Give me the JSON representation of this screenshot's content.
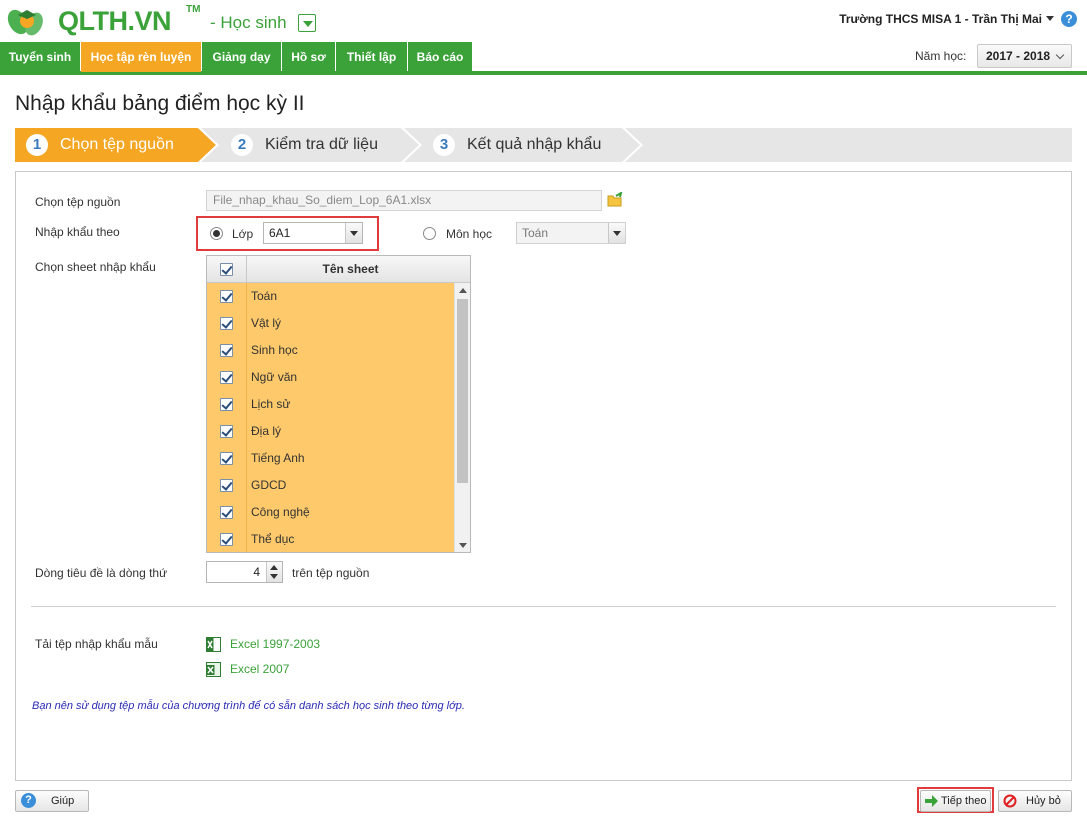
{
  "header": {
    "logo_text": "QLTH.VN",
    "logo_tm": "TM",
    "app_switch": "- Học sinh",
    "user_label": "Trường THCS MISA 1 - Trần Thị Mai"
  },
  "nav": {
    "tabs": [
      "Tuyển sinh",
      "Học tập rèn luyện",
      "Giảng dạy",
      "Hồ sơ",
      "Thiết lập",
      "Báo cáo"
    ],
    "active_tab": "Học tập rèn luyện",
    "year_label": "Năm học:",
    "year_value": "2017 - 2018"
  },
  "page": {
    "title": "Nhập khẩu bảng điểm học kỳ II"
  },
  "wizard": {
    "steps": [
      {
        "num": "1",
        "label": "Chọn tệp nguồn",
        "active": true
      },
      {
        "num": "2",
        "label": "Kiểm tra dữ liệu",
        "active": false
      },
      {
        "num": "3",
        "label": "Kết quả nhập khẩu",
        "active": false
      }
    ]
  },
  "form": {
    "source_label": "Chọn tệp nguồn",
    "source_file": "File_nhap_khau_So_diem_Lop_6A1.xlsx",
    "import_by_label": "Nhập khẩu theo",
    "class_radio_label": "Lớp",
    "class_value": "6A1",
    "subject_radio_label": "Môn học",
    "subject_value": "Toán",
    "import_by_selected": "Lớp",
    "sheet_label": "Chọn sheet nhập khẩu",
    "sheet_column_header": "Tên sheet",
    "sheets": [
      "Toán",
      "Vật lý",
      "Sinh học",
      "Ngữ văn",
      "Lịch sử",
      "Địa lý",
      "Tiếng Anh",
      "GDCD",
      "Công nghệ",
      "Thể dục"
    ],
    "header_row_label": "Dòng tiêu đề là dòng thứ",
    "header_row_value": "4",
    "header_row_suffix": "trên tệp nguồn",
    "template_label": "Tải tệp nhập khẩu mẫu",
    "template_links": [
      "Excel 1997-2003",
      "Excel 2007"
    ],
    "hint": "Bạn nên sử dụng tệp mẫu của chương trình để có sẵn danh sách học sinh theo từng lớp."
  },
  "footer": {
    "help_label": "Giúp",
    "next_label": "Tiếp theo",
    "cancel_label": "Hủy bỏ"
  },
  "colors": {
    "brand_green": "#3aa239",
    "active_orange": "#f5a623",
    "grid_row": "#fdc96a",
    "highlight_red": "#e03c3c"
  }
}
